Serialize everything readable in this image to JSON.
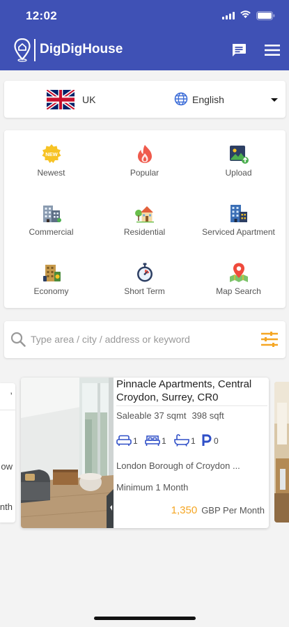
{
  "status_bar": {
    "time": "12:02"
  },
  "app": {
    "title": "DigDigHouse"
  },
  "locale": {
    "region": "UK",
    "language": "English"
  },
  "categories": [
    {
      "label": "Newest",
      "icon": "new-badge-icon"
    },
    {
      "label": "Popular",
      "icon": "flame-icon"
    },
    {
      "label": "Upload",
      "icon": "upload-photo-icon"
    },
    {
      "label": "Commercial",
      "icon": "office-building-icon"
    },
    {
      "label": "Residential",
      "icon": "house-icon"
    },
    {
      "label": "Serviced Apartment",
      "icon": "apartment-building-icon"
    },
    {
      "label": "Economy",
      "icon": "economy-building-icon"
    },
    {
      "label": "Short Term",
      "icon": "stopwatch-icon"
    },
    {
      "label": "Map Search",
      "icon": "map-pin-icon"
    }
  ],
  "search": {
    "placeholder": "Type area / city / address or keyword"
  },
  "peek_left": {
    "lines": [
      ",",
      "ow",
      "nth"
    ]
  },
  "listing": {
    "title": "Pinnacle Apartments, Central Croydon, Surrey, CR0",
    "saleable": "Saleable 37 sqmt",
    "sqft": "398 sqft",
    "features": [
      {
        "icon": "sofa-icon",
        "count": "1"
      },
      {
        "icon": "bed-icon",
        "count": "1"
      },
      {
        "icon": "bathtub-icon",
        "count": "1"
      },
      {
        "icon": "parking-icon",
        "count": "0"
      }
    ],
    "borough": "London Borough of Croydon ...",
    "min_stay": "Minimum 1 Month",
    "price": "1,350",
    "price_unit": "GBP Per Month"
  },
  "colors": {
    "primary": "#3f51b5",
    "accent": "#f5a623",
    "feature_blue": "#2f4fc7"
  }
}
